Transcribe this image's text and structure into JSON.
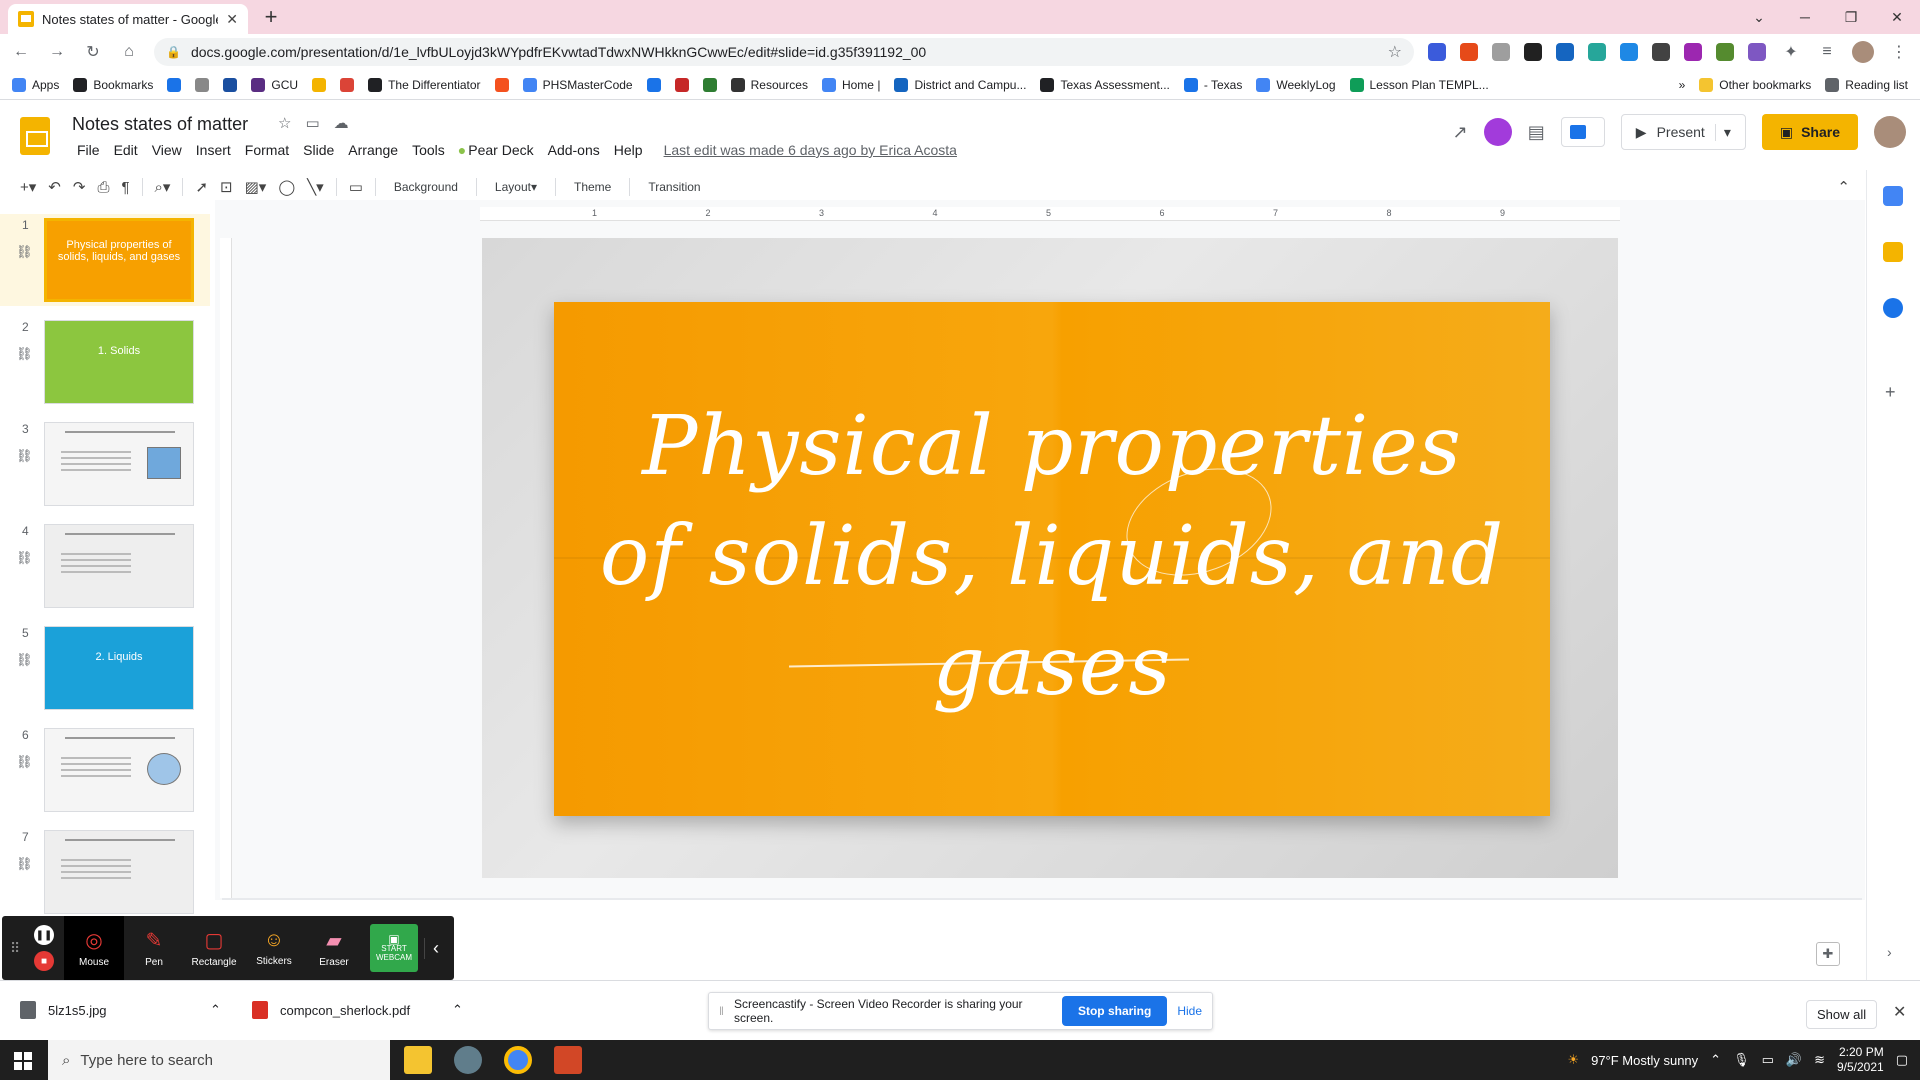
{
  "browser": {
    "tab_title": "Notes states of matter - Google",
    "url": "docs.google.com/presentation/d/1e_lvfbULoyjd3kWYpdfrEKvwtadTdwxNWHkknGCwwEc/edit#slide=id.g35f391192_00"
  },
  "bookmarks": [
    {
      "label": "Apps",
      "color": "#4285f4"
    },
    {
      "label": "Bookmarks",
      "color": "#202124"
    },
    {
      "label": "",
      "color": "#1a73e8"
    },
    {
      "label": "",
      "color": "#888888"
    },
    {
      "label": "",
      "color": "#1a4fa0"
    },
    {
      "label": "GCU",
      "color": "#5a2d82"
    },
    {
      "label": "",
      "color": "#f4b400"
    },
    {
      "label": "",
      "color": "#db4437"
    },
    {
      "label": "The Differentiator",
      "color": "#202124"
    },
    {
      "label": "",
      "color": "#f4511e"
    },
    {
      "label": "PHSMasterCode",
      "color": "#4285f4"
    },
    {
      "label": "",
      "color": "#1a73e8"
    },
    {
      "label": "",
      "color": "#c62828"
    },
    {
      "label": "",
      "color": "#2e7d32"
    },
    {
      "label": "Resources",
      "color": "#333333"
    },
    {
      "label": "Home |",
      "color": "#4285f4"
    },
    {
      "label": "District and Campu...",
      "color": "#1565c0"
    },
    {
      "label": "Texas Assessment...",
      "color": "#202124"
    },
    {
      "label": "- Texas",
      "color": "#1a73e8"
    },
    {
      "label": "WeeklyLog",
      "color": "#4285f4"
    },
    {
      "label": "Lesson Plan TEMPL...",
      "color": "#0f9d58"
    }
  ],
  "bookmarks_right": {
    "other": "Other bookmarks",
    "reading": "Reading list"
  },
  "doc": {
    "title": "Notes states of matter",
    "menu": [
      "File",
      "Edit",
      "View",
      "Insert",
      "Format",
      "Slide",
      "Arrange",
      "Tools",
      "Pear Deck",
      "Add-ons",
      "Help"
    ],
    "last_edit": "Last edit was made 6 days ago by Erica Acosta",
    "present_label": "Present",
    "share_label": "Share"
  },
  "toolbar": {
    "background": "Background",
    "layout": "Layout",
    "theme": "Theme",
    "transition": "Transition"
  },
  "ruler": [
    "1",
    "2",
    "3",
    "4",
    "5",
    "6",
    "7",
    "8",
    "9"
  ],
  "slides": [
    {
      "num": "1",
      "title": "Physical properties of solids, liquids, and gases",
      "bg": "#f7a000",
      "selected": true
    },
    {
      "num": "2",
      "title": "1. Solids",
      "bg": "#8cc63f",
      "selected": false
    },
    {
      "num": "3",
      "title": "",
      "bg": "#f5f5f5",
      "selected": false
    },
    {
      "num": "4",
      "title": "",
      "bg": "#eeeeee",
      "selected": false
    },
    {
      "num": "5",
      "title": "2. Liquids",
      "bg": "#1ba1d9",
      "selected": false
    },
    {
      "num": "6",
      "title": "",
      "bg": "#f5f5f5",
      "selected": false
    },
    {
      "num": "7",
      "title": "",
      "bg": "#eeeeee",
      "selected": false
    }
  ],
  "current_slide": {
    "title": "Physical properties of solids, liquids, and gases",
    "line1": "Physical properties",
    "line2": "of solids, liquids, and",
    "line3": "gases",
    "paper_color": "#f7a000"
  },
  "screencastify": {
    "tools": [
      "Mouse",
      "Pen",
      "Rectangle",
      "Stickers",
      "Eraser"
    ],
    "webcam_label": "START WEBCAM"
  },
  "downloads": [
    {
      "name": "5lz1s5.jpg",
      "color": "#5f6368"
    },
    {
      "name": "compcon_sherlock.pdf",
      "color": "#d93025"
    }
  ],
  "share_notice": {
    "text": "Screencastify - Screen Video Recorder is sharing your screen.",
    "stop": "Stop sharing",
    "hide": "Hide"
  },
  "show_all": "Show all",
  "taskbar": {
    "search_placeholder": "Type here to search",
    "weather": "97°F  Mostly sunny",
    "time": "2:20 PM",
    "date": "9/5/2021"
  }
}
